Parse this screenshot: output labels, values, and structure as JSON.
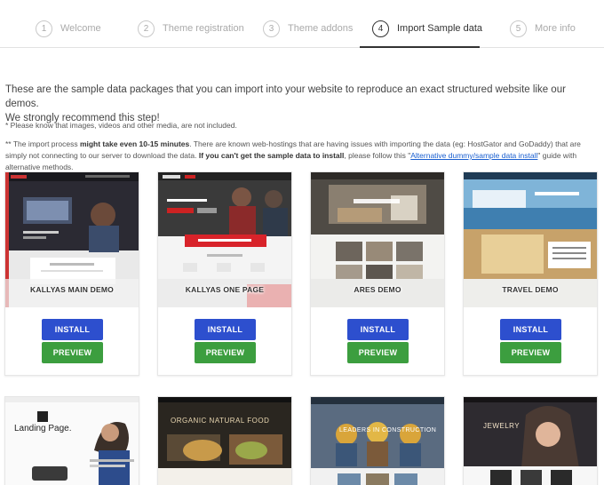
{
  "steps": [
    {
      "num": "1",
      "label": "Welcome",
      "active": false
    },
    {
      "num": "2",
      "label": "Theme registration",
      "active": false
    },
    {
      "num": "3",
      "label": "Theme addons",
      "active": false
    },
    {
      "num": "4",
      "label": "Import Sample data",
      "active": true
    },
    {
      "num": "5",
      "label": "More info",
      "active": false
    }
  ],
  "intro": {
    "line1": "These are the sample data packages that you can import into your website to reproduce an exact structured website like our demos.",
    "line2": "We strongly recommend this step!"
  },
  "notes": {
    "note1": "* Please know that images, videos and other media, are not included.",
    "note2_a": "** The import process ",
    "note2_b": "might take even 10-15 minutes",
    "note2_c": ". There are known web-hostings that are having issues with importing the data (eg: HostGator and GoDaddy) that are simply not connecting to our server to download the data. ",
    "note2_d": "If you can't get the sample data to install",
    "note2_e": ", please follow this \"",
    "note2_link": "Alternative dummy/sample data install",
    "note2_f": "\" guide with alternative methods."
  },
  "buttons": {
    "install": "INSTALL",
    "preview": "PREVIEW"
  },
  "demos": [
    {
      "title": "KALLYAS MAIN DEMO"
    },
    {
      "title": "KALLYAS ONE PAGE"
    },
    {
      "title": "ARES DEMO"
    },
    {
      "title": "TRAVEL DEMO"
    }
  ],
  "demos_row2": [
    {
      "thumb_text": "Landing Page."
    },
    {
      "thumb_text": "ORGANIC NATURAL FOOD"
    },
    {
      "thumb_text": "LEADERS IN CONSTRUCTION"
    },
    {
      "thumb_text": "JEWELRY"
    }
  ],
  "colors": {
    "install": "#2d4fce",
    "preview": "#3c9e3f",
    "link": "#1a5fd0"
  }
}
